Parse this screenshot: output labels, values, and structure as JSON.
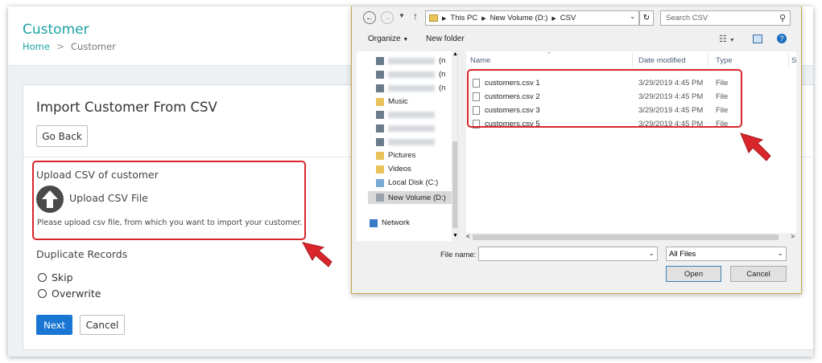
{
  "header": {
    "title": "Customer",
    "breadcrumb": {
      "home": "Home",
      "separator": ">",
      "current": "Customer"
    }
  },
  "card": {
    "title": "Import Customer From CSV",
    "go_back_label": "Go Back",
    "upload": {
      "heading": "Upload CSV of customer",
      "button_label": "Upload CSV File",
      "help_text": "Please upload csv file, from which you want to import your customer."
    },
    "duplicates": {
      "heading": "Duplicate Records",
      "options": [
        "Skip",
        "Overwrite"
      ]
    },
    "next_label": "Next",
    "cancel_label": "Cancel"
  },
  "dialog": {
    "path": [
      "This PC",
      "New Volume (D:)",
      "CSV"
    ],
    "search_placeholder": "Search CSV",
    "toolbar": {
      "organize": "Organize",
      "new_folder": "New folder"
    },
    "tree": {
      "blurred_suffix": "(n",
      "music": "Music",
      "pictures": "Pictures",
      "videos": "Videos",
      "local_disk": "Local Disk (C:)",
      "new_volume": "New Volume (D:)",
      "network": "Network"
    },
    "columns": {
      "name": "Name",
      "date_modified": "Date modified",
      "type": "Type",
      "size_partial": "S"
    },
    "files": [
      {
        "name": "customers.csv 1",
        "date": "3/29/2019 4:45 PM",
        "type": "File"
      },
      {
        "name": "customers.csv 2",
        "date": "3/29/2019 4:45 PM",
        "type": "File"
      },
      {
        "name": "customers.csv 3",
        "date": "3/29/2019 4:45 PM",
        "type": "File"
      },
      {
        "name": "customers.csv 5",
        "date": "3/29/2019 4:45 PM",
        "type": "File"
      }
    ],
    "file_name_label": "File name:",
    "file_name_value": "",
    "filter_value": "All Files",
    "open_label": "Open",
    "cancel_label": "Cancel"
  },
  "colors": {
    "accent": "#1ba2a3",
    "primary_button": "#1976d2",
    "highlight": "#d9262b",
    "dialog_border": "#c9a84b"
  }
}
